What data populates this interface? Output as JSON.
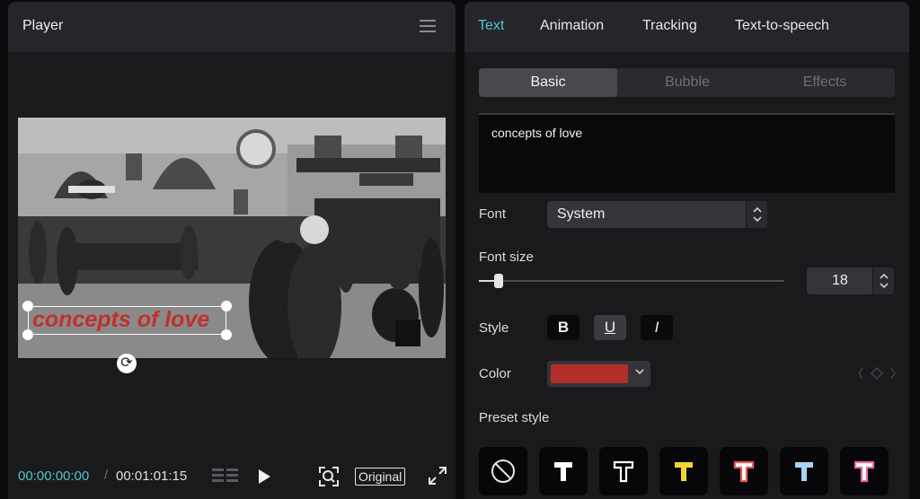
{
  "player": {
    "title": "Player",
    "caption": "concepts of love",
    "timecode_current": "00:00:00:00",
    "timecode_separator": "/",
    "timecode_total": "00:01:01:15",
    "original_label": "Original"
  },
  "editor": {
    "tabs": [
      "Text",
      "Animation",
      "Tracking",
      "Text-to-speech"
    ],
    "active_tab": "Text",
    "segments": [
      "Basic",
      "Bubble",
      "Effects"
    ],
    "active_segment": "Basic",
    "text_value": "concepts of love",
    "font_label": "Font",
    "font_value": "System",
    "font_size_label": "Font size",
    "font_size_value": "18",
    "font_size_level": 0.05,
    "style_label": "Style",
    "style_buttons": [
      "B",
      "U",
      "I"
    ],
    "color_label": "Color",
    "color_value": "#b22f29",
    "preset_label": "Preset style",
    "presets": [
      {
        "name": "none",
        "fill": "",
        "stroke": ""
      },
      {
        "name": "white",
        "fill": "#ffffff",
        "stroke": ""
      },
      {
        "name": "outline",
        "fill": "#000000",
        "stroke": "#ffffff"
      },
      {
        "name": "yellow",
        "fill": "#f2d630",
        "stroke": ""
      },
      {
        "name": "white-red-outline",
        "fill": "#ffffff",
        "stroke": "#e45a5a"
      },
      {
        "name": "light-blue",
        "fill": "#a7d4f4",
        "stroke": ""
      },
      {
        "name": "pink-outline",
        "fill": "#ffffff",
        "stroke": "#e86aa6"
      }
    ]
  },
  "colors": {
    "accent": "#4fc4cf",
    "panel": "#1a1a1d",
    "caption": "#c0312b"
  }
}
